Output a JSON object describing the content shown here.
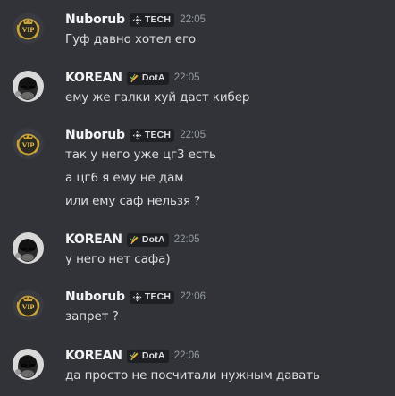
{
  "messages": [
    {
      "author": "Nuborub",
      "avatar": "vip-badge-avatar",
      "tag": {
        "label": "TECH",
        "icon": "diamond-move-icon"
      },
      "time": "22:05",
      "lines": [
        "Гуф давно хотел его"
      ]
    },
    {
      "author": "KOREAN",
      "avatar": "photo-avatar",
      "tag": {
        "label": "DotA",
        "icon": "pencil-icon"
      },
      "time": "22:05",
      "lines": [
        "ему же галки хуй даст кибер"
      ]
    },
    {
      "author": "Nuborub",
      "avatar": "vip-badge-avatar",
      "tag": {
        "label": "TECH",
        "icon": "diamond-move-icon"
      },
      "time": "22:05",
      "lines": [
        "так у него уже цг3 есть",
        "а цг6 я ему не дам",
        "или ему саф нельзя ?"
      ]
    },
    {
      "author": "KOREAN",
      "avatar": "photo-avatar",
      "tag": {
        "label": "DotA",
        "icon": "pencil-icon"
      },
      "time": "22:05",
      "lines": [
        "у него нет сафа)"
      ]
    },
    {
      "author": "Nuborub",
      "avatar": "vip-badge-avatar",
      "tag": {
        "label": "TECH",
        "icon": "diamond-move-icon"
      },
      "time": "22:06",
      "lines": [
        "запрет ?"
      ]
    },
    {
      "author": "KOREAN",
      "avatar": "photo-avatar",
      "tag": {
        "label": "DotA",
        "icon": "pencil-icon"
      },
      "time": "22:06",
      "lines": [
        "да просто не посчитали нужным давать"
      ]
    }
  ],
  "colors": {
    "background": "#313338",
    "username": "#f2f3f5",
    "message_text": "#dbdee1",
    "timestamp": "#949ba4",
    "tag_background": "#1e1f22",
    "pencil_tag": "#f0b232",
    "vip_gold": "#c9a33a"
  }
}
